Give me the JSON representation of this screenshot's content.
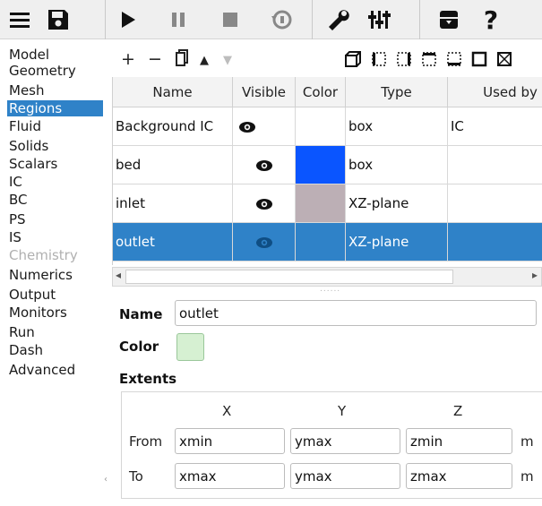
{
  "toolbar": {
    "buttons": [
      {
        "name": "menu-icon",
        "glyph": "☰"
      },
      {
        "name": "save-icon",
        "glyph": "💾"
      },
      {
        "name": "play-icon",
        "glyph": "▶"
      },
      {
        "name": "pause-icon",
        "glyph": "⏸"
      },
      {
        "name": "stop-icon",
        "glyph": "■"
      },
      {
        "name": "reset-icon",
        "glyph": "↺"
      },
      {
        "name": "wrench-icon",
        "glyph": "🔧"
      },
      {
        "name": "sliders-icon",
        "glyph": "🎚"
      },
      {
        "name": "archive-icon",
        "glyph": "🗄"
      },
      {
        "name": "help-icon",
        "glyph": "?"
      }
    ]
  },
  "sidebar": {
    "items": [
      {
        "label": "Model",
        "state": "normal"
      },
      {
        "label": "Geometry",
        "state": "normal"
      },
      {
        "label": "Mesh",
        "state": "normal"
      },
      {
        "label": "Regions",
        "state": "selected"
      },
      {
        "label": "Fluid",
        "state": "normal"
      },
      {
        "label": "Solids",
        "state": "normal"
      },
      {
        "label": "Scalars",
        "state": "normal"
      },
      {
        "label": "IC",
        "state": "normal"
      },
      {
        "label": "BC",
        "state": "normal"
      },
      {
        "label": "PS",
        "state": "normal"
      },
      {
        "label": "IS",
        "state": "normal"
      },
      {
        "label": "Chemistry",
        "state": "disabled"
      },
      {
        "label": "Numerics",
        "state": "normal"
      },
      {
        "label": "Output",
        "state": "normal"
      },
      {
        "label": "Monitors",
        "state": "normal"
      },
      {
        "label": "Run",
        "state": "normal"
      },
      {
        "label": "Dash",
        "state": "normal"
      },
      {
        "label": "Advanced",
        "state": "normal"
      }
    ]
  },
  "region_tools": {
    "add": "+",
    "remove": "−",
    "duplicate": "⧉",
    "up": "▲",
    "down": "▼"
  },
  "table": {
    "headers": [
      "Name",
      "Visible",
      "Color",
      "Type",
      "Used by"
    ],
    "rows": [
      {
        "name": "Background IC",
        "visible": "👁",
        "color": "#ffffff",
        "type": "box",
        "used_by": "IC",
        "selected": false
      },
      {
        "name": "bed",
        "visible": "👁",
        "color": "#0a55ff",
        "type": "box",
        "used_by": "",
        "selected": false
      },
      {
        "name": "inlet",
        "visible": "👁",
        "color": "#bcafb5",
        "type": "XZ-plane",
        "used_by": "",
        "selected": false
      },
      {
        "name": "outlet",
        "visible": "👁",
        "color": "#2f82c8",
        "type": "XZ-plane",
        "used_by": "",
        "selected": true
      }
    ]
  },
  "form": {
    "name_label": "Name",
    "name_value": "outlet",
    "color_label": "Color",
    "color_value": "#d6f0d2",
    "extents_label": "Extents",
    "axes": [
      "X",
      "Y",
      "Z"
    ],
    "from_label": "From",
    "to_label": "To",
    "from": [
      "xmin",
      "ymax",
      "zmin"
    ],
    "to": [
      "xmax",
      "ymax",
      "zmax"
    ],
    "unit": "m"
  }
}
